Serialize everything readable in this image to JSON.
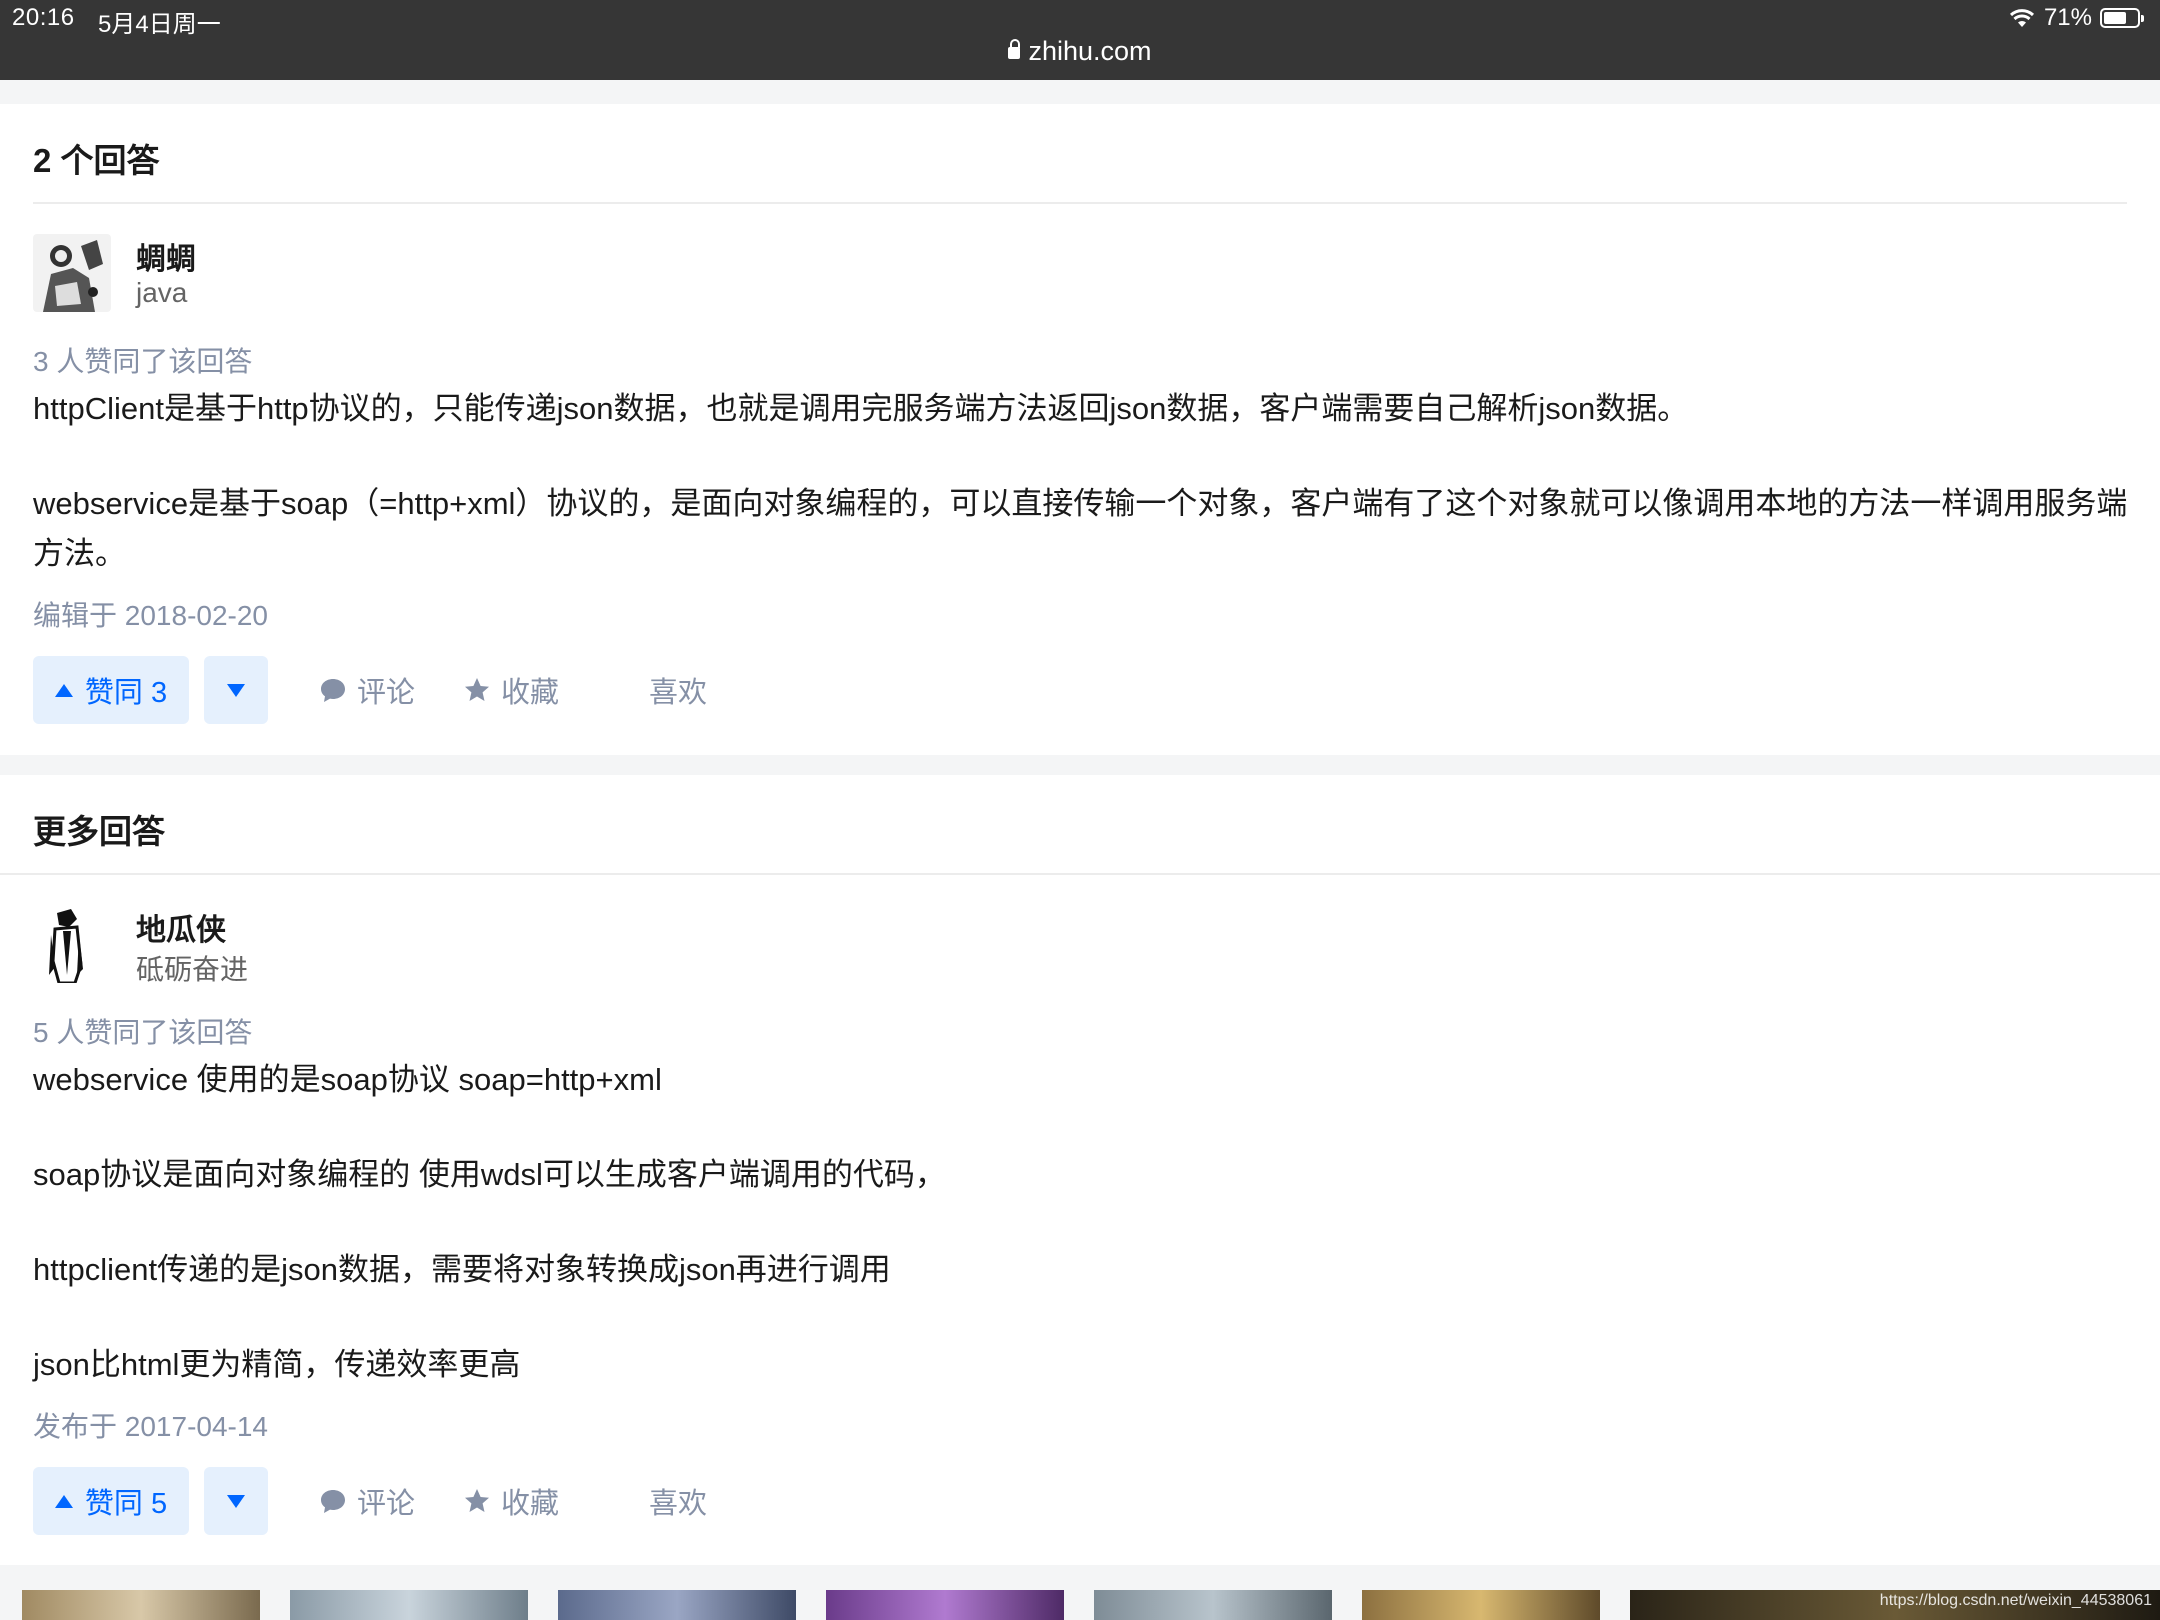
{
  "status_bar": {
    "time": "20:16",
    "date": "5月4日周一",
    "battery": "71%",
    "battery_level": 0.71,
    "url": "zhihu.com"
  },
  "answers_card": {
    "heading": "2 个回答",
    "answer": {
      "author_name": "蜩蜩",
      "author_bio": "java",
      "votes_text": "3 人赞同了该回答",
      "paragraphs": [
        "httpClient是基于http协议的，只能传递json数据，也就是调用完服务端方法返回json数据，客户端需要自己解析json数据。",
        "webservice是基于soap（=http+xml）协议的，是面向对象编程的，可以直接传输一个对象，客户端有了这个对象就可以像调用本地的方法一样调用服务端方法。"
      ],
      "time_text": "编辑于 2018-02-20",
      "actions": {
        "vote_up": "赞同 3",
        "comment": "评论",
        "collect": "收藏",
        "like": "喜欢"
      }
    }
  },
  "more_card": {
    "heading": "更多回答",
    "answer": {
      "author_name": "地瓜侠",
      "author_bio": "砥砺奋进",
      "votes_text": "5 人赞同了该回答",
      "paragraphs": [
        "webservice 使用的是soap协议 soap=http+xml",
        "soap协议是面向对象编程的 使用wdsl可以生成客户端调用的代码，",
        "httpclient传递的是json数据，需要将对象转换成json再进行调用",
        "json比html更为精简，传递效率更高"
      ],
      "time_text": "发布于 2017-04-14",
      "actions": {
        "vote_up": "赞同 5",
        "comment": "评论",
        "collect": "收藏",
        "like": "喜欢"
      }
    }
  },
  "watermark": "https://blog.csdn.net/weixin_44538061",
  "colors": {
    "accent": "#0066ff",
    "accent_bg": "#e5f0fd",
    "meta": "#8590a6",
    "statusbar": "#363636"
  }
}
